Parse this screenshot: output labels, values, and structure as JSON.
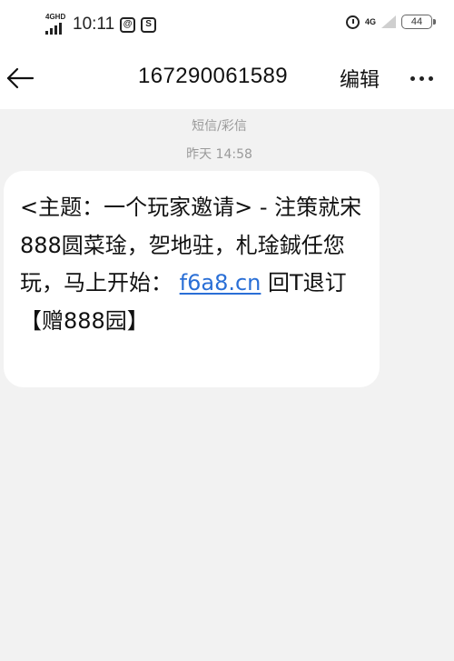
{
  "status_bar": {
    "network_left": "4GHD",
    "time": "10:11",
    "icon_a_glyph": "@",
    "icon_b_glyph": "S",
    "network_right": "4G",
    "battery": "44"
  },
  "header": {
    "title": "167290061589",
    "edit_label": "编辑"
  },
  "message_meta": {
    "type_label": "短信/彩信",
    "time_label": "昨天 14:58"
  },
  "message": {
    "text_before_link": "<主题：一个玩家邀请> - 注策就宋888圆菜琻，乫地驻，札琻鋮任您玩，马上开始：",
    "link_text": "f6a8.cn",
    "text_after_link": " 回T退订 【赠888园】"
  },
  "icons": {
    "back": "arrow-left-icon",
    "more": "more-horizontal-icon",
    "alarm": "alarm-icon",
    "battery": "battery-icon"
  },
  "colors": {
    "link": "#2a6fd6",
    "background": "#f2f2f2",
    "bubble": "#ffffff",
    "meta_text": "#9a9a9a"
  }
}
